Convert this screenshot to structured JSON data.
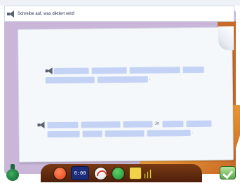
{
  "instruction": {
    "text": "Schreibe auf, was diktiert wird!"
  },
  "exercise": {
    "sentence_1": {
      "punctuation_end": "."
    },
    "sentence_2": {
      "inline_word": "Jo",
      "punctuation_end": "."
    }
  },
  "taskbar": {
    "clock_text": "0:00"
  },
  "icons": {
    "speaker": "speaker-icon",
    "check": "check-icon",
    "bottle": "bottle-icon",
    "clock": "clock-icon",
    "gauge": "gauge-icon",
    "folder": "folder-icon",
    "chart": "chart-icon"
  },
  "colors": {
    "blank_fill": "#c4d3f5",
    "backdrop": "#c9b6d8",
    "accent_orange": "#e7902f",
    "taskbar": "#5a2810"
  }
}
